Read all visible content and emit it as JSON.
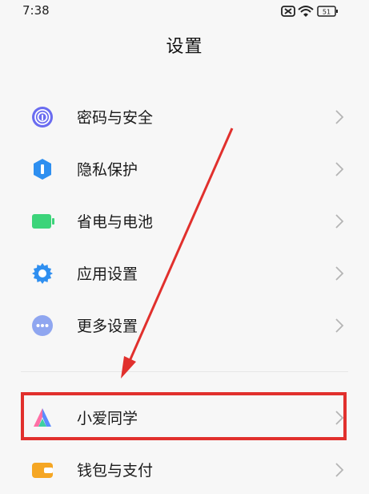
{
  "status_bar": {
    "time": "7:38",
    "battery": "51"
  },
  "header": {
    "title": "设置"
  },
  "menu": {
    "items": [
      {
        "label": "密码与安全",
        "icon": "fingerprint-icon"
      },
      {
        "label": "隐私保护",
        "icon": "privacy-shield-icon"
      },
      {
        "label": "省电与电池",
        "icon": "battery-icon"
      },
      {
        "label": "应用设置",
        "icon": "gear-icon"
      },
      {
        "label": "更多设置",
        "icon": "more-dots-icon"
      },
      {
        "label": "小爱同学",
        "icon": "xiaoai-icon"
      },
      {
        "label": "钱包与支付",
        "icon": "wallet-icon"
      }
    ]
  },
  "colors": {
    "annotation_red": "#e1302d",
    "fingerprint": "#6a6cf0",
    "privacy": "#2e8ff0",
    "battery": "#3cd47a",
    "gear": "#2f8ff0",
    "more": "#8fa6f0",
    "wallet": "#f5a623"
  }
}
